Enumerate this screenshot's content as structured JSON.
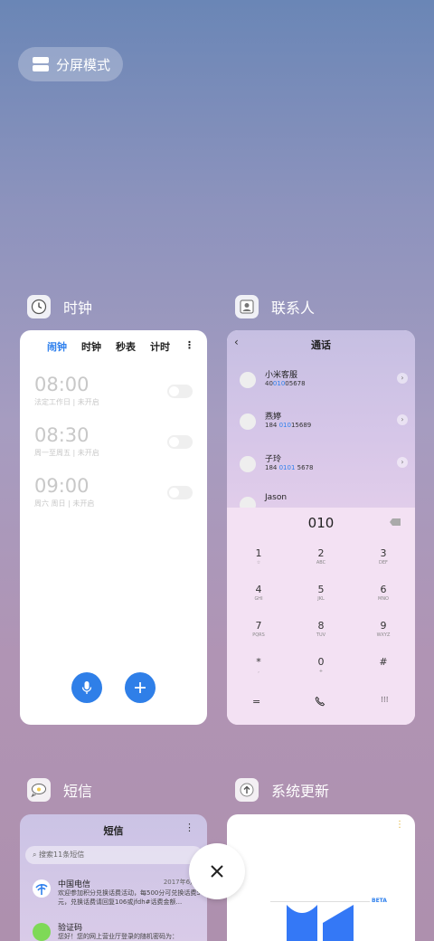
{
  "split_mode": {
    "label": "分屏模式"
  },
  "apps": {
    "clock": {
      "name": "时钟"
    },
    "contacts": {
      "name": "联系人"
    },
    "sms": {
      "name": "短信"
    },
    "update": {
      "name": "系统更新"
    }
  },
  "clock": {
    "tabs": [
      "闹钟",
      "时钟",
      "秒表",
      "计时"
    ],
    "alarms": [
      {
        "time": "08:00",
        "desc": "法定工作日 | 未开启"
      },
      {
        "time": "08:30",
        "desc": "周一至周五 | 未开启"
      },
      {
        "time": "09:00",
        "desc": "周六 周日 | 未开启"
      }
    ]
  },
  "contacts": {
    "title": "通话",
    "list": [
      {
        "name": "小米客服",
        "num_pre": "40",
        "num_hl": "010",
        "num_post": "05678"
      },
      {
        "name": "燕婷",
        "num_pre": "184 ",
        "num_hl": "010",
        "num_post": "15689"
      },
      {
        "name": "子玲",
        "num_pre": "184 ",
        "num_hl": "0101",
        "num_post": " 5678"
      },
      {
        "name": "Jason",
        "num_pre": "",
        "num_hl": "",
        "num_post": ""
      }
    ],
    "dialed": "010",
    "keys": [
      {
        "d": "1",
        "l": "☆"
      },
      {
        "d": "2",
        "l": "ABC"
      },
      {
        "d": "3",
        "l": "DEF"
      },
      {
        "d": "4",
        "l": "GHI"
      },
      {
        "d": "5",
        "l": "JKL"
      },
      {
        "d": "6",
        "l": "MNO"
      },
      {
        "d": "7",
        "l": "PQRS"
      },
      {
        "d": "8",
        "l": "TUV"
      },
      {
        "d": "9",
        "l": "WXYZ"
      },
      {
        "d": "*",
        "l": ","
      },
      {
        "d": "0",
        "l": "+"
      },
      {
        "d": "#",
        "l": ""
      }
    ]
  },
  "sms": {
    "title": "短信",
    "search_placeholder": "搜索11条短信",
    "messages": [
      {
        "name": "中国电信",
        "time": "2017年6月30",
        "text": "欢迎参加积分兑换话费活动，每500分可兑换话费5元，兑换话费请回复106或jfdh#话费金额..."
      },
      {
        "name": "验证码",
        "time": "",
        "text": "您好！您的网上营业厅登录的随机密码为："
      }
    ]
  },
  "update": {
    "badge": "BETA"
  },
  "colors": {
    "accent": "#2f80ed"
  }
}
